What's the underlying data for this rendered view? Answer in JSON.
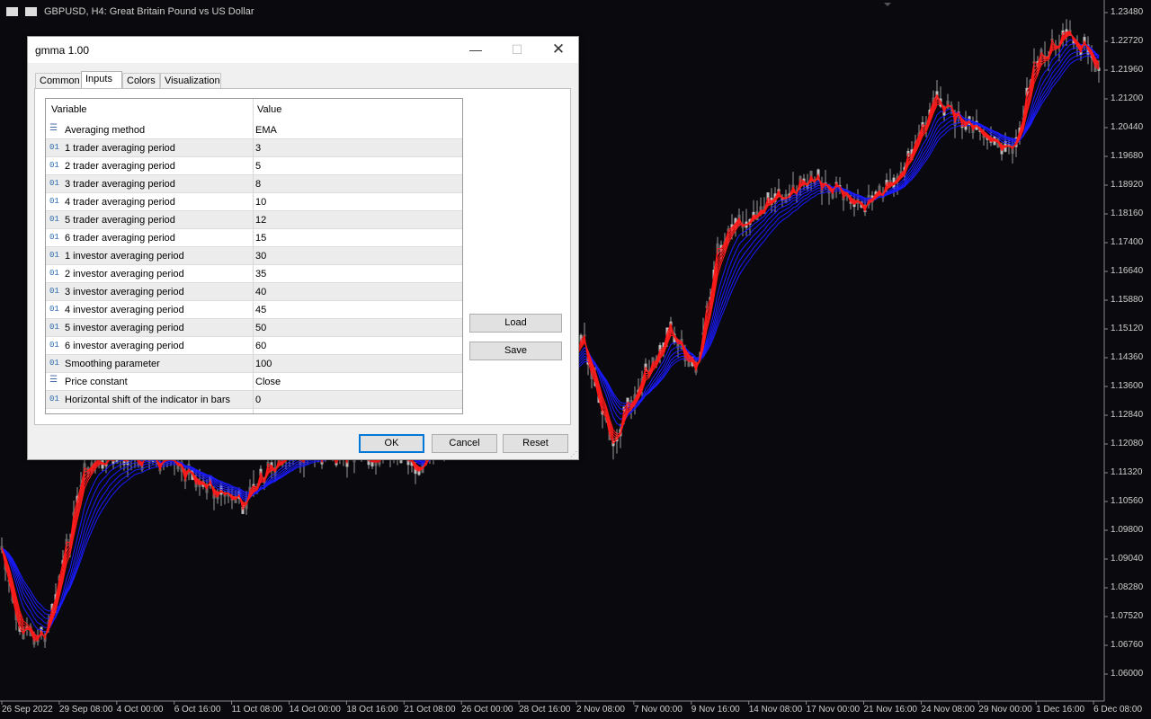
{
  "chart": {
    "symbol_text": "GBPUSD, H4:  Great Britain Pound vs US Dollar",
    "price_labels": [
      "1.23480",
      "1.22720",
      "1.21960",
      "1.21200",
      "1.20440",
      "1.19680",
      "1.18920",
      "1.18160",
      "1.17400",
      "1.16640",
      "1.15880",
      "1.15120",
      "1.14360",
      "1.13600",
      "1.12840",
      "1.12080",
      "1.11320",
      "1.10560",
      "1.09800",
      "1.09040",
      "1.08280",
      "1.07520",
      "1.06760",
      "1.06000"
    ],
    "time_labels": [
      "26 Sep 2022",
      "29 Sep 08:00",
      "4 Oct 00:00",
      "6 Oct 16:00",
      "11 Oct 08:00",
      "14 Oct 00:00",
      "18 Oct 16:00",
      "21 Oct 08:00",
      "26 Oct 00:00",
      "28 Oct 16:00",
      "2 Nov 08:00",
      "7 Nov 00:00",
      "9 Nov 16:00",
      "14 Nov 08:00",
      "17 Nov 00:00",
      "21 Nov 16:00",
      "24 Nov 08:00",
      "29 Nov 00:00",
      "1 Dec 16:00",
      "6 Dec 08:00"
    ],
    "colors": {
      "background": "#0a0a0e",
      "trader": "#ff1a1a",
      "investor": "#1a1aff",
      "candle": "#9a9a9a"
    }
  },
  "dialog": {
    "title": "gmma 1.00",
    "window_buttons": {
      "minimize": "—",
      "maximize": "☐",
      "close": "✕"
    },
    "tabs": [
      {
        "label": "Common"
      },
      {
        "label": "Inputs",
        "active": true
      },
      {
        "label": "Colors"
      },
      {
        "label": "Visualization"
      }
    ],
    "columns": {
      "variable": "Variable",
      "value": "Value"
    },
    "rows": [
      {
        "icon": "enum",
        "name": "Averaging method",
        "value": "EMA"
      },
      {
        "icon": "01",
        "name": "1 trader averaging period",
        "value": "3"
      },
      {
        "icon": "01",
        "name": "2 trader averaging period",
        "value": "5"
      },
      {
        "icon": "01",
        "name": "3 trader averaging period",
        "value": "8"
      },
      {
        "icon": "01",
        "name": "4 trader averaging period",
        "value": "10"
      },
      {
        "icon": "01",
        "name": "5 trader averaging period",
        "value": "12"
      },
      {
        "icon": "01",
        "name": "6 trader averaging period",
        "value": "15"
      },
      {
        "icon": "01",
        "name": "1 investor averaging period",
        "value": "30"
      },
      {
        "icon": "01",
        "name": "2 investor averaging period",
        "value": "35"
      },
      {
        "icon": "01",
        "name": "3 investor averaging period",
        "value": "40"
      },
      {
        "icon": "01",
        "name": "4 investor averaging period",
        "value": "45"
      },
      {
        "icon": "01",
        "name": "5 investor averaging period",
        "value": "50"
      },
      {
        "icon": "01",
        "name": "6 investor averaging period",
        "value": "60"
      },
      {
        "icon": "01",
        "name": "Smoothing parameter",
        "value": "100"
      },
      {
        "icon": "enum",
        "name": "Price constant",
        "value": "Close"
      },
      {
        "icon": "01",
        "name": "Horizontal shift of the indicator in bars",
        "value": "0"
      }
    ],
    "side_buttons": {
      "load": "Load",
      "save": "Save"
    },
    "footer_buttons": {
      "ok": "OK",
      "cancel": "Cancel",
      "reset": "Reset"
    }
  }
}
